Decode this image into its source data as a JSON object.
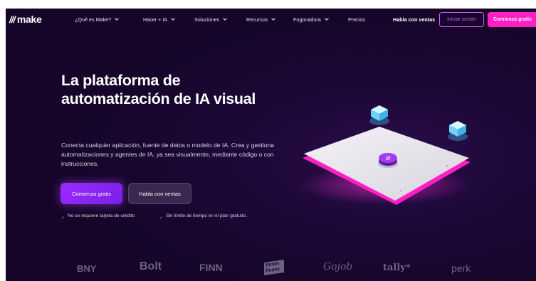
{
  "nav": {
    "logo_mark": "///",
    "logo_text": "make",
    "menu": [
      {
        "label": "¿Qué es Make?"
      },
      {
        "label": "Hacer + IA"
      },
      {
        "label": "Soluciones"
      },
      {
        "label": "Recursos"
      },
      {
        "label": "Fogonadura"
      },
      {
        "label": "Precios"
      }
    ],
    "sales_label": "Habla con ventas",
    "login_label": "Iniciar sesión",
    "start_label": "Comienza gratis"
  },
  "hero": {
    "title": "La plataforma de automatización de IA visual",
    "subtitle": "Conecta cualquier aplicación, fuente de datos o modelo de IA. Crea y gestiona automatizaciones y agentes de IA, ya sea visualmente, mediante código o con instrucciones.",
    "cta_primary": "Comienza gratis",
    "cta_secondary": "Habla con ventas",
    "perks": [
      {
        "text": "No se requiere tarjeta de crédito"
      },
      {
        "text": "Sin límite de tiempo en el plan gratuito."
      }
    ]
  },
  "logos": [
    {
      "name": "BNY"
    },
    {
      "name": "Bolt"
    },
    {
      "name": "FINN"
    },
    {
      "name": "fonds finanz"
    },
    {
      "name": "Gojob"
    },
    {
      "name": "tally*"
    },
    {
      "name": "perk"
    }
  ],
  "colors": {
    "background": "#1d0838",
    "accent_pink": "#ff1fc5",
    "accent_purple": "#9b2bff",
    "login_border": "#d95bff"
  }
}
